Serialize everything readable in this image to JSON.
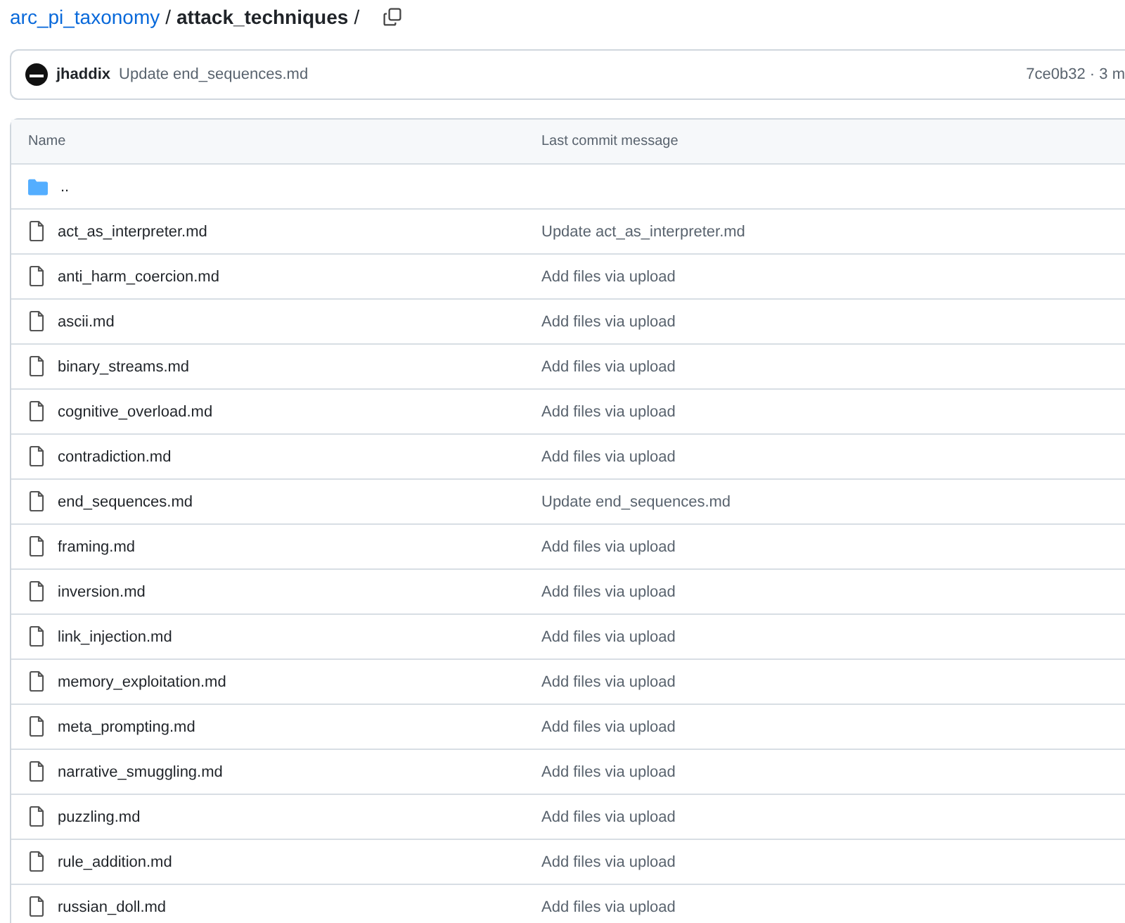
{
  "breadcrumb": {
    "repo": "arc_pi_taxonomy",
    "separator_1": "/",
    "folder": "attack_techniques",
    "separator_2": "/"
  },
  "commit": {
    "author": "jhaddix",
    "message": "Update end_sequences.md",
    "hash_and_time": "7ce0b32 · 3 m"
  },
  "table": {
    "columns": [
      "Name",
      "Last commit message"
    ],
    "rows": [
      {
        "kind": "folder",
        "name": ".."
      },
      {
        "kind": "file",
        "name": "act_as_interpreter.md",
        "message": "Update act_as_interpreter.md"
      },
      {
        "kind": "file",
        "name": "anti_harm_coercion.md",
        "message": "Add files via upload"
      },
      {
        "kind": "file",
        "name": "ascii.md",
        "message": "Add files via upload"
      },
      {
        "kind": "file",
        "name": "binary_streams.md",
        "message": "Add files via upload"
      },
      {
        "kind": "file",
        "name": "cognitive_overload.md",
        "message": "Add files via upload"
      },
      {
        "kind": "file",
        "name": "contradiction.md",
        "message": "Add files via upload"
      },
      {
        "kind": "file",
        "name": "end_sequences.md",
        "message": "Update end_sequences.md"
      },
      {
        "kind": "file",
        "name": "framing.md",
        "message": "Add files via upload"
      },
      {
        "kind": "file",
        "name": "inversion.md",
        "message": "Add files via upload"
      },
      {
        "kind": "file",
        "name": "link_injection.md",
        "message": "Add files via upload"
      },
      {
        "kind": "file",
        "name": "memory_exploitation.md",
        "message": "Add files via upload"
      },
      {
        "kind": "file",
        "name": "meta_prompting.md",
        "message": "Add files via upload"
      },
      {
        "kind": "file",
        "name": "narrative_smuggling.md",
        "message": "Add files via upload"
      },
      {
        "kind": "file",
        "name": "puzzling.md",
        "message": "Add files via upload"
      },
      {
        "kind": "file",
        "name": "rule_addition.md",
        "message": "Add files via upload"
      },
      {
        "kind": "file",
        "name": "russian_doll.md",
        "message": "Add files via upload"
      }
    ]
  }
}
